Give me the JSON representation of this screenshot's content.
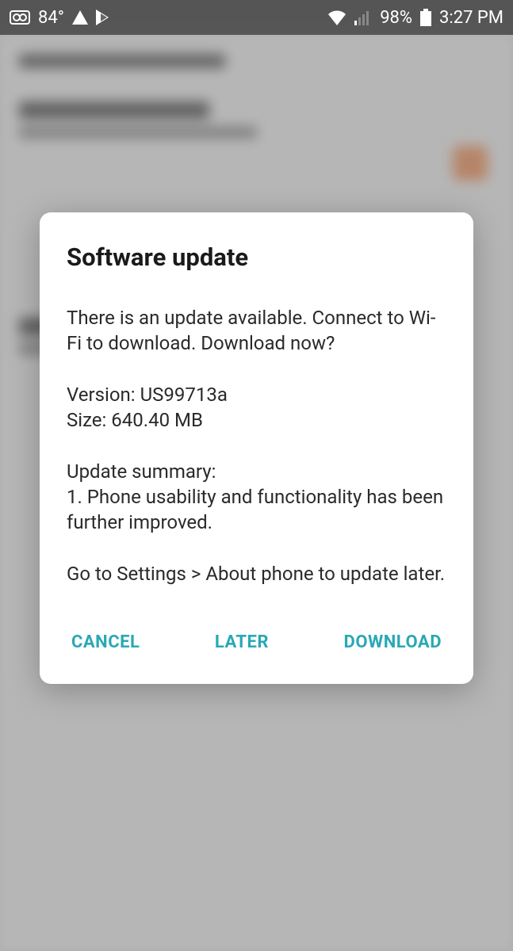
{
  "statusbar": {
    "temperature": "84°",
    "battery_pct": "98%",
    "time": "3:27 PM"
  },
  "dialog": {
    "title": "Software update",
    "intro": "There is an update available. Connect to Wi-Fi to download. Download now?",
    "version_label": "Version: ",
    "version": "US99713a",
    "size_label": "Size: ",
    "size": "640.40 MB",
    "summary_header": "Update summary:",
    "summary_item_1": "1. Phone usability and functionality has been further improved.",
    "later_hint": "Go to Settings > About phone to update later.",
    "actions": {
      "cancel": "CANCEL",
      "later": "LATER",
      "download": "DOWNLOAD"
    }
  }
}
